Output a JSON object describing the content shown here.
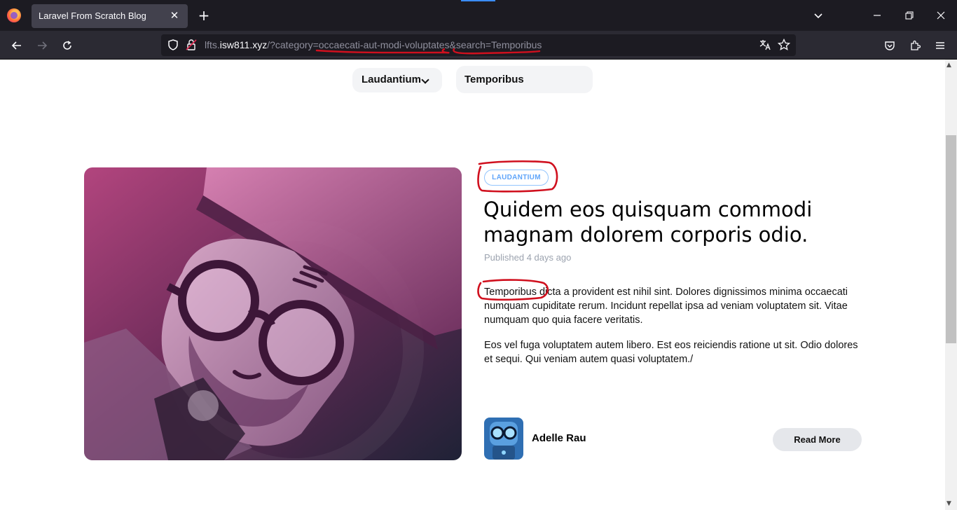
{
  "browser": {
    "tab_title": "Laravel From Scratch Blog",
    "tab_close": "✕",
    "new_tab": "+",
    "url": {
      "prefix": "lfts.",
      "host": "isw811.xyz",
      "path": "/?category=occaecati-aut-modi-voluptates&search=Temporibus"
    },
    "window_controls": {
      "list": "⌄",
      "minimize": "—",
      "restore": "❐",
      "close": "✕"
    }
  },
  "filters": {
    "category_label": "Laudantium",
    "search_value": "Temporibus"
  },
  "post": {
    "category": "LAUDANTIUM",
    "title": "Quidem eos quisquam commodi magnam dolorem corporis odio.",
    "published": "Published 4 days ago",
    "paragraphs": [
      "Temporibus dicta a provident est nihil sint. Dolores dignissimos minima occaecati numquam cupiditate rerum. Incidunt repellat ipsa ad veniam voluptatem sit. Vitae numquam quo quia facere veritatis.",
      "Eos vel fuga voluptatem autem libero. Est eos reiciendis ratione ut sit. Odio dolores et sequi. Qui veniam autem quasi voluptatem./"
    ],
    "author": "Adelle Rau",
    "read_more": "Read More"
  },
  "colors": {
    "annotation": "#d0101e",
    "badge": "#60a5fa",
    "chrome_dark": "#1c1b22"
  }
}
